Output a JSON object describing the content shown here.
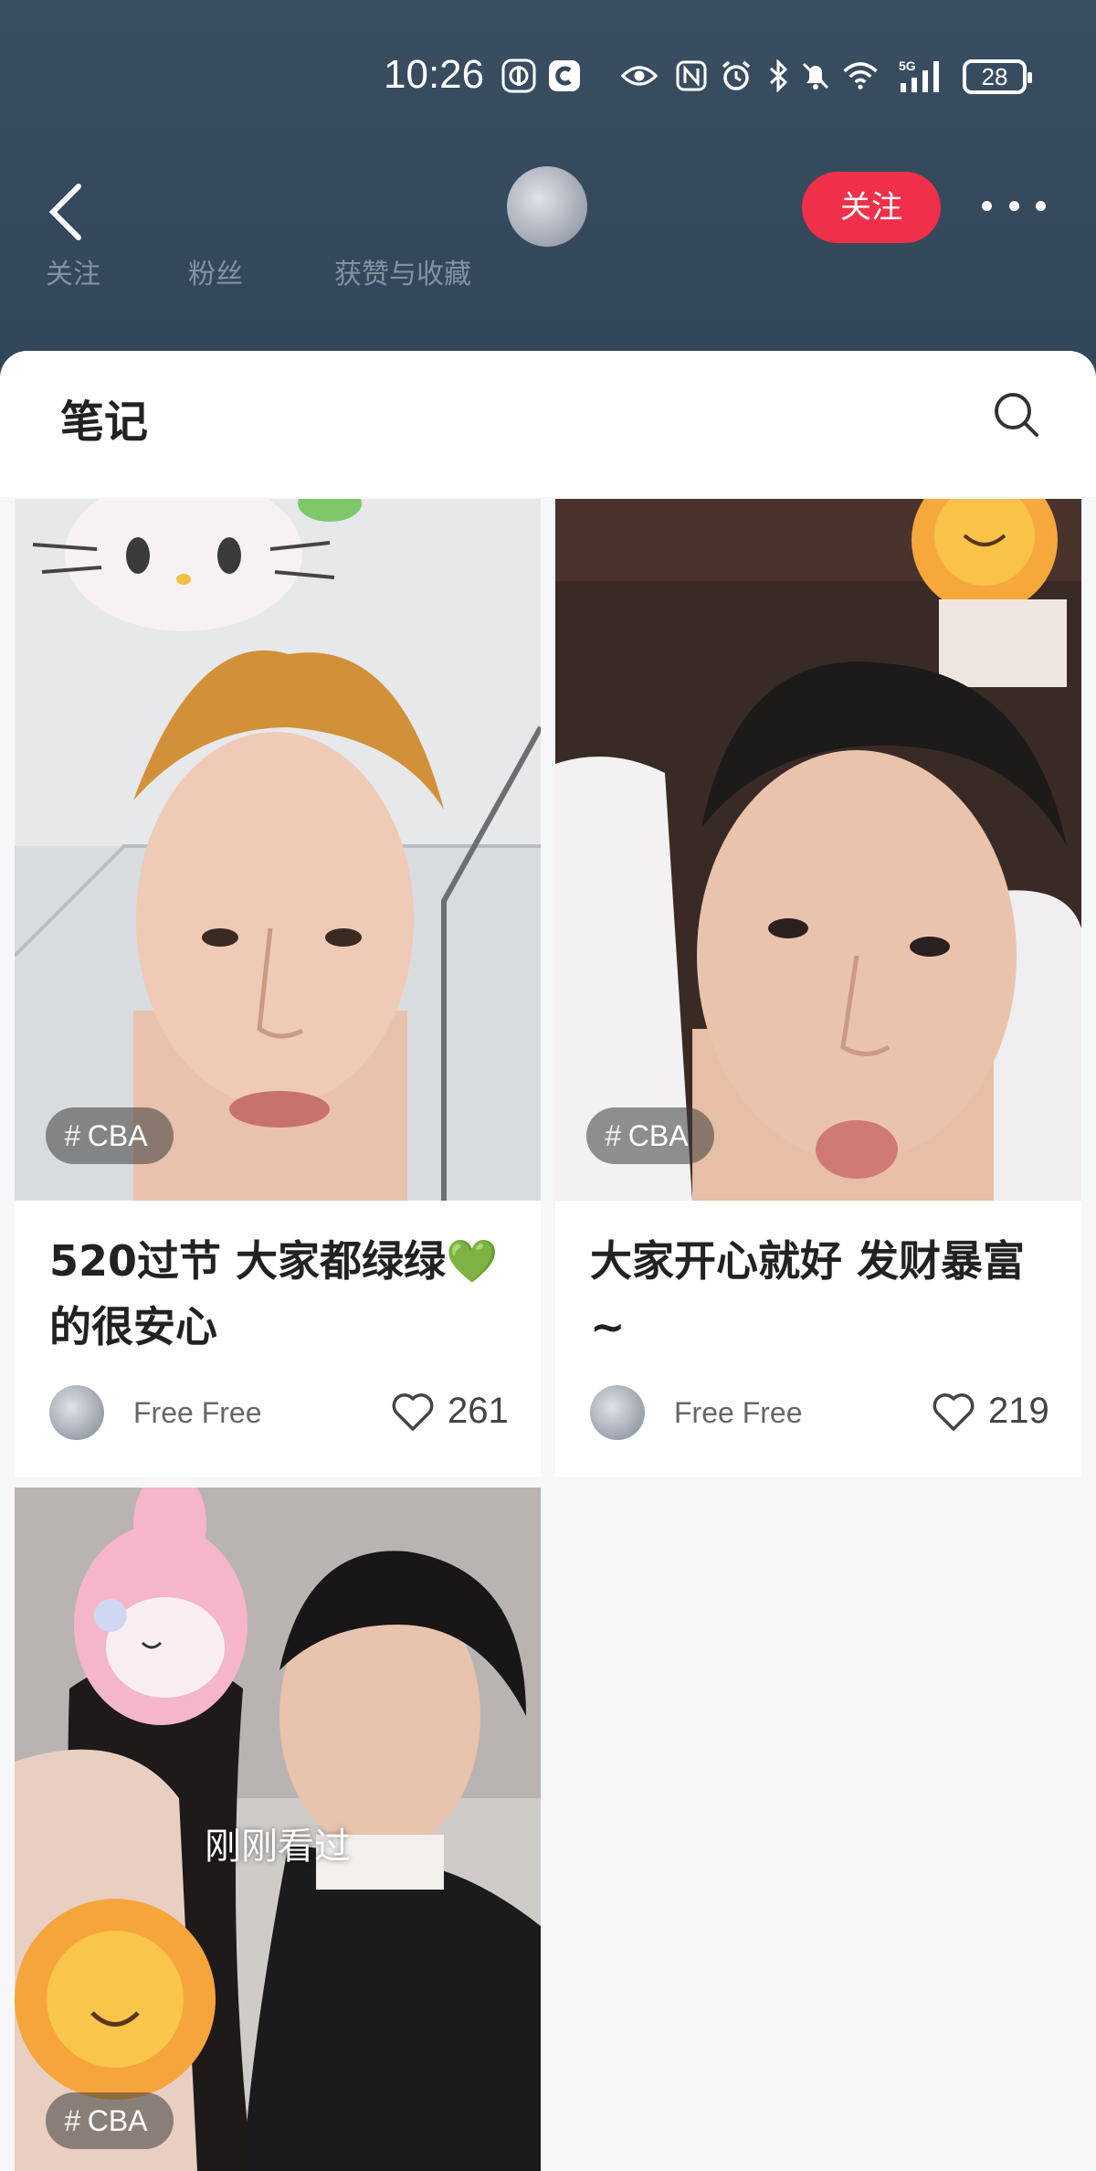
{
  "status_bar": {
    "time": "10:26",
    "battery": "28",
    "network": "5G",
    "icons": [
      "abc-app-icon",
      "browser-app-icon",
      "eye-icon",
      "nfc-icon",
      "alarm-icon",
      "bluetooth-icon",
      "mute-icon",
      "wifi-icon",
      "signal-icon"
    ]
  },
  "nav": {
    "follow_label": "关注",
    "faded_stats": [
      "关注",
      "粉丝",
      "获赞与收藏"
    ]
  },
  "sheet": {
    "title": "笔记"
  },
  "cards": [
    {
      "tag": "CBA",
      "title_line1": "520过节 大家都绿绿💚",
      "title_line2": "的很安心",
      "author": "Free Free",
      "likes": "261"
    },
    {
      "tag": "CBA",
      "title_line1": "大家开心就好 发财暴富",
      "title_line2": "~",
      "author": "Free Free",
      "likes": "219"
    },
    {
      "tag": "CBA",
      "recent_label": "刚刚看过"
    }
  ],
  "colors": {
    "header_bg": "#35495c",
    "follow_button": "#f0304a",
    "sheet_bg": "#f5f7f9"
  }
}
